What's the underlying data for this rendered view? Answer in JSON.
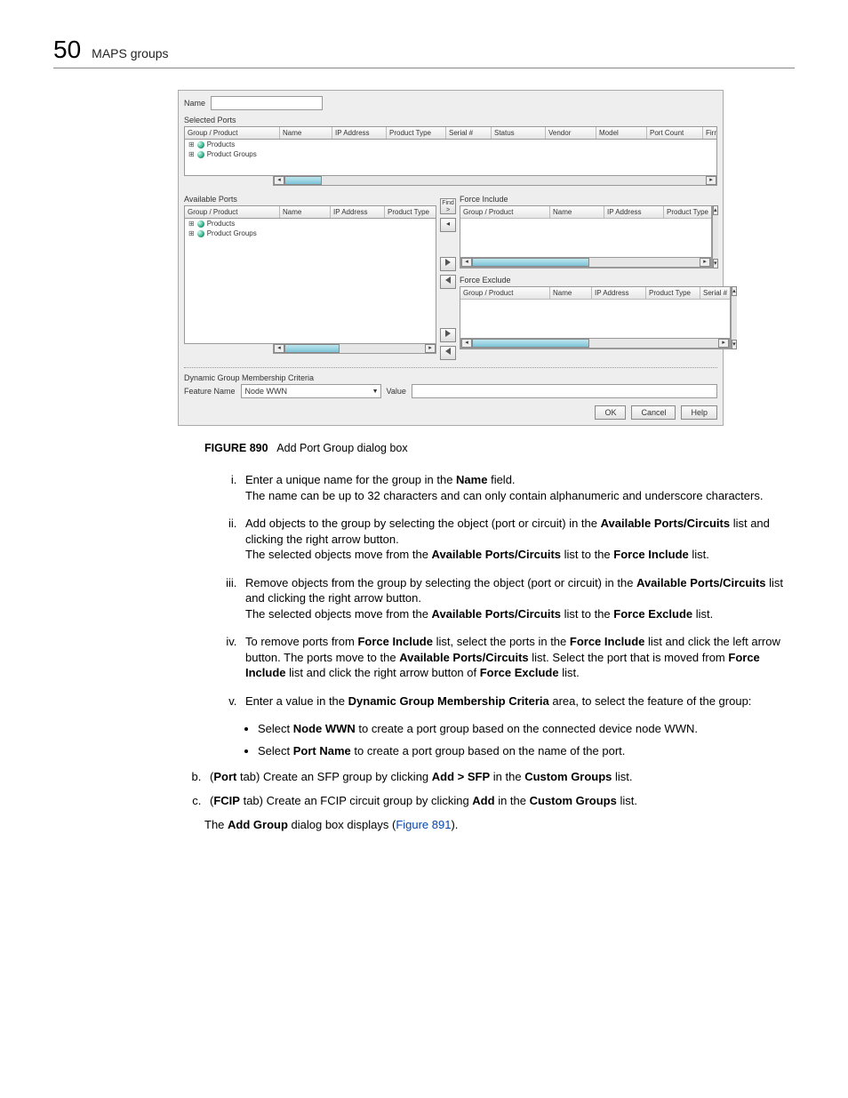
{
  "page": {
    "chapter_number": "50",
    "chapter_title": "MAPS groups"
  },
  "dialog": {
    "name_label": "Name",
    "selected_ports_title": "Selected Ports",
    "available_ports_title": "Available Ports",
    "force_include_title": "Force Include",
    "force_exclude_title": "Force Exclude",
    "find_btn": "Find >",
    "cols": {
      "group": "Group / Product",
      "name": "Name",
      "ip": "IP Address",
      "ptype": "Product Type",
      "serial": "Serial #",
      "status": "Status",
      "vendor": "Vendor",
      "model": "Model",
      "port_count": "Port Count",
      "firm": "Firm"
    },
    "force_exclude_cols": {
      "name": "Name",
      "ip": "IP Address",
      "ptype": "Product Type",
      "serial": "Serial #"
    },
    "tree": {
      "products": "Products",
      "product_groups": "Product Groups"
    },
    "dyn_title": "Dynamic Group Membership Criteria",
    "feature_label": "Feature Name",
    "feature_value": "Node WWN",
    "value_label": "Value",
    "ok": "OK",
    "cancel": "Cancel",
    "help": "Help"
  },
  "figure": {
    "label": "FIGURE 890",
    "caption": "Add Port Group dialog box"
  },
  "steps": {
    "i_a": "Enter a unique name for the group in the ",
    "i_b": "Name",
    "i_c": " field.",
    "i_d": "The name can be up to 32 characters and can only contain alphanumeric and underscore characters.",
    "ii_a": "Add objects to the group by selecting the object (port or circuit) in the ",
    "ii_b": "Available Ports/Circuits",
    "ii_c": " list and clicking the right arrow button.",
    "ii_d": "The selected objects move from the ",
    "ii_e": "Available Ports/Circuits",
    "ii_f": " list to the ",
    "ii_g": "Force Include",
    "ii_h": " list.",
    "iii_a": "Remove objects from the group by selecting the object (port or circuit) in the ",
    "iii_b": "Available Ports/Circuits",
    "iii_c": " list and clicking the right arrow button.",
    "iii_d": "The selected objects move from the ",
    "iii_e": "Available Ports/Circuits",
    "iii_f": " list to the ",
    "iii_g": "Force Exclude",
    "iii_h": " list.",
    "iv_a": "To remove ports from ",
    "iv_b": "Force Include",
    "iv_c": " list, select the ports in the ",
    "iv_d": "Force Include",
    "iv_e": " list and click the left arrow button. The ports move to the ",
    "iv_f": "Available Ports/Circuits",
    "iv_g": " list. Select the port that is moved from ",
    "iv_h": "Force Include",
    "iv_i": " list and click the right arrow button of ",
    "iv_j": "Force Exclude",
    "iv_k": " list.",
    "v_a": "Enter a value in the ",
    "v_b": "Dynamic Group Membership Criteria",
    "v_c": " area, to select the feature of the group:",
    "bul1_a": "Select ",
    "bul1_b": "Node WWN",
    "bul1_c": " to create a port group based on the connected device node WWN.",
    "bul2_a": "Select ",
    "bul2_b": "Port Name",
    "bul2_c": " to create a port group based on the name of the port."
  },
  "letters": {
    "b_a": "(",
    "b_b": "Port",
    "b_c": " tab) Create an SFP group by clicking ",
    "b_d": "Add > SFP",
    "b_e": " in the ",
    "b_f": "Custom Groups",
    "b_g": " list.",
    "c_a": "(",
    "c_b": "FCIP",
    "c_c": " tab) Create an FCIP circuit group by clicking ",
    "c_d": "Add",
    "c_e": " in the ",
    "c_f": "Custom Groups",
    "c_g": " list."
  },
  "final": {
    "a": "The ",
    "b": "Add Group",
    "c": " dialog box displays (",
    "d": "Figure 891",
    "e": ")."
  }
}
